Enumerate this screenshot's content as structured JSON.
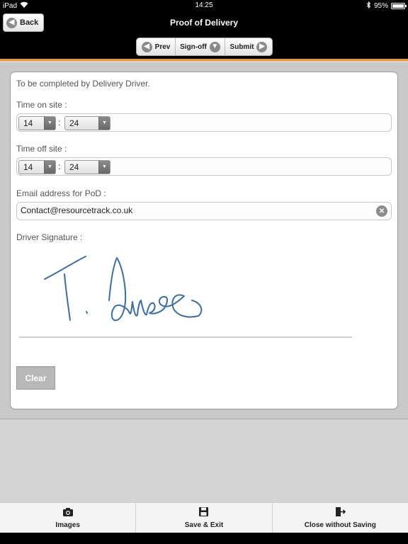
{
  "status_bar": {
    "device": "iPad",
    "time": "14:25",
    "battery": "95%",
    "battery_level": 0.95
  },
  "header": {
    "title": "Proof of Delivery",
    "back_label": "Back",
    "nav": {
      "prev_label": "Prev",
      "signoff_label": "Sign-off",
      "submit_label": "Submit"
    }
  },
  "form": {
    "instruction": "To be completed by Delivery Driver.",
    "time_on_site": {
      "label": "Time on site :",
      "hour": "14",
      "minute": "24"
    },
    "time_off_site": {
      "label": "Time off site :",
      "hour": "14",
      "minute": "24"
    },
    "email": {
      "label": "Email address for PoD :",
      "value": "Contact@resourcetrack.co.uk"
    },
    "signature": {
      "label": "Driver Signature :",
      "ink_color": "#3a6ea8"
    },
    "clear_label": "Clear"
  },
  "toolbar": {
    "images_label": "Images",
    "save_exit_label": "Save & Exit",
    "close_label": "Close without Saving"
  },
  "colors": {
    "accent": "#f09a1a",
    "header_bg": "#000000"
  }
}
